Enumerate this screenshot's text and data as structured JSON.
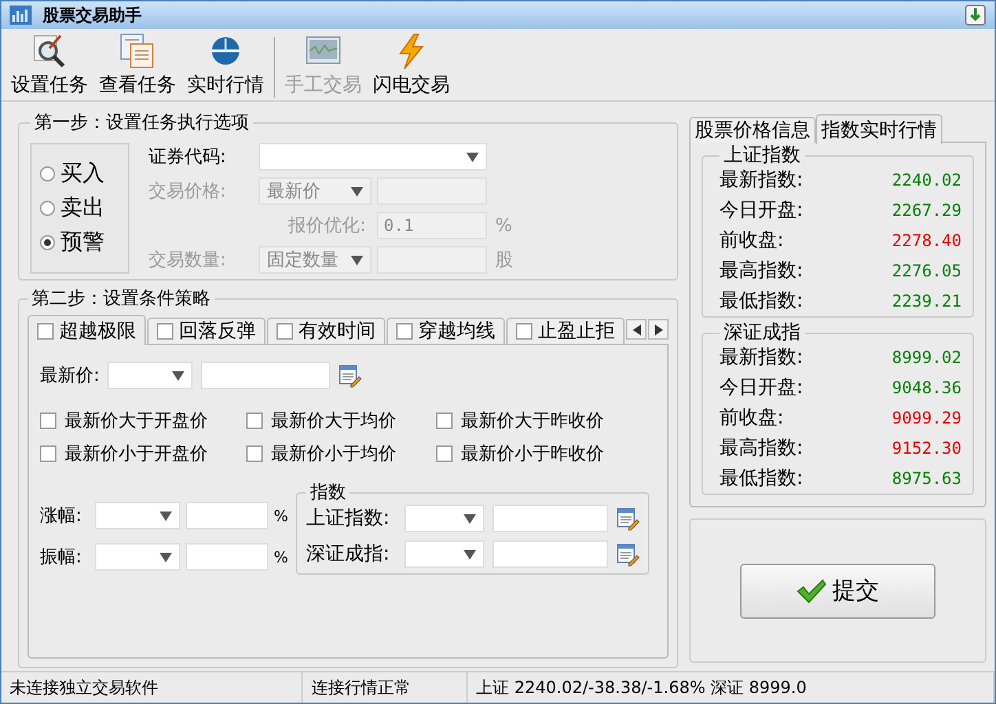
{
  "window": {
    "title": "股票交易助手"
  },
  "toolbar": [
    {
      "label": "设置任务",
      "kind": "magnifier",
      "disabled": false
    },
    {
      "label": "查看任务",
      "kind": "document",
      "disabled": false
    },
    {
      "label": "实时行情",
      "kind": "globe",
      "disabled": false
    },
    {
      "label": "手工交易",
      "kind": "monitor",
      "disabled": true
    },
    {
      "label": "闪电交易",
      "kind": "lightning",
      "disabled": false
    }
  ],
  "step1": {
    "title": "第一步：设置任务执行选项",
    "trade_types": [
      {
        "label": "买入",
        "selected": false
      },
      {
        "label": "卖出",
        "selected": false
      },
      {
        "label": "预警",
        "selected": true
      }
    ],
    "stock_code": {
      "label": "证券代码:",
      "disabled": false
    },
    "price": {
      "label": "交易价格:",
      "value": "最新价",
      "disabled": true
    },
    "optimize": {
      "label": "报价优化:",
      "value": "0.1",
      "unit": "%",
      "disabled": true
    },
    "quantity": {
      "label": "交易数量:",
      "value": "固定数量",
      "unit": "股",
      "disabled": true
    }
  },
  "step2": {
    "title": "第二步：设置条件策略",
    "tabs": [
      {
        "label": "超越极限",
        "selected": true,
        "checked": false
      },
      {
        "label": "回落反弹",
        "selected": false,
        "checked": false
      },
      {
        "label": "有效时间",
        "selected": false,
        "checked": false
      },
      {
        "label": "穿越均线",
        "selected": false,
        "checked": false
      },
      {
        "label": "止盈止拒",
        "selected": false,
        "checked": false
      }
    ],
    "latest_price": {
      "label": "最新价:"
    },
    "conditions": [
      {
        "label": "最新价大于开盘价",
        "checked": false
      },
      {
        "label": "最新价大于均价",
        "checked": false
      },
      {
        "label": "最新价大于昨收价",
        "checked": false
      },
      {
        "label": "最新价小于开盘价",
        "checked": false
      },
      {
        "label": "最新价小于均价",
        "checked": false
      },
      {
        "label": "最新价小于昨收价",
        "checked": false
      }
    ],
    "ranges": [
      {
        "label": "涨幅:",
        "unit": "%"
      },
      {
        "label": "振幅:",
        "unit": "%"
      }
    ],
    "index_group": {
      "title": "指数",
      "rows": [
        {
          "label": "上证指数:"
        },
        {
          "label": "深证成指:"
        }
      ]
    }
  },
  "market": {
    "tabs": [
      {
        "label": "股票价格信息",
        "selected": false
      },
      {
        "label": "指数实时行情",
        "selected": true
      }
    ],
    "groups": [
      {
        "title": "上证指数",
        "rows": [
          {
            "label": "最新指数:",
            "value": "2240.02",
            "color": "#008000"
          },
          {
            "label": "今日开盘:",
            "value": "2267.29",
            "color": "#008000"
          },
          {
            "label": "前收盘:",
            "value": "2278.40",
            "color": "#e00000"
          },
          {
            "label": "最高指数:",
            "value": "2276.05",
            "color": "#008000"
          },
          {
            "label": "最低指数:",
            "value": "2239.21",
            "color": "#008000"
          }
        ]
      },
      {
        "title": "深证成指",
        "rows": [
          {
            "label": "最新指数:",
            "value": "8999.02",
            "color": "#008000"
          },
          {
            "label": "今日开盘:",
            "value": "9048.36",
            "color": "#008000"
          },
          {
            "label": "前收盘:",
            "value": "9099.29",
            "color": "#e00000"
          },
          {
            "label": "最高指数:",
            "value": "9152.30",
            "color": "#e00000"
          },
          {
            "label": "最低指数:",
            "value": "8975.63",
            "color": "#008000"
          }
        ]
      }
    ]
  },
  "submit": {
    "label": "提交"
  },
  "status_bar": [
    "未连接独立交易软件",
    "连接行情正常",
    "上证 2240.02/-38.38/-1.68%  深证 8999.0"
  ]
}
